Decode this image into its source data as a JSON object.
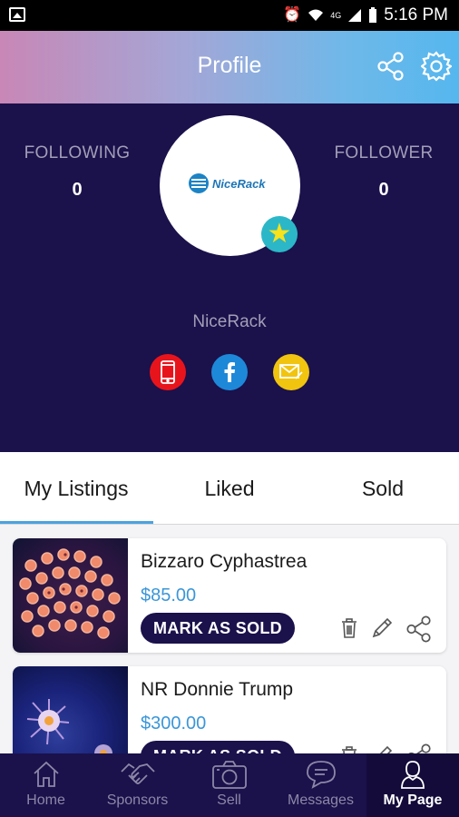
{
  "status_bar": {
    "time": "5:16 PM",
    "network": "4G"
  },
  "header": {
    "title": "Profile"
  },
  "profile": {
    "following_label": "FOLLOWING",
    "following_count": "0",
    "follower_label": "FOLLOWER",
    "follower_count": "0",
    "avatar_logo_text": "NiceRack",
    "name": "NiceRack"
  },
  "tabs": [
    {
      "label": "My Listings",
      "active": true
    },
    {
      "label": "Liked",
      "active": false
    },
    {
      "label": "Sold",
      "active": false
    }
  ],
  "listings": [
    {
      "title": "Bizzaro Cyphastrea",
      "price": "$85.00",
      "button_label": "MARK AS SOLD"
    },
    {
      "title": "NR Donnie Trump",
      "price": "$300.00",
      "button_label": "MARK AS SOLD"
    }
  ],
  "bottom_nav": [
    {
      "label": "Home",
      "icon": "home-icon"
    },
    {
      "label": "Sponsors",
      "icon": "handshake-icon"
    },
    {
      "label": "Sell",
      "icon": "camera-icon"
    },
    {
      "label": "Messages",
      "icon": "chat-icon"
    },
    {
      "label": "My Page",
      "icon": "person-icon",
      "active": true
    }
  ],
  "colors": {
    "profile_bg": "#1b114b",
    "accent_blue": "#4aa3df",
    "price_blue": "#3a96d8",
    "phone_red": "#e8141c",
    "facebook_blue": "#1e88d8",
    "mail_yellow": "#f1c40f"
  }
}
